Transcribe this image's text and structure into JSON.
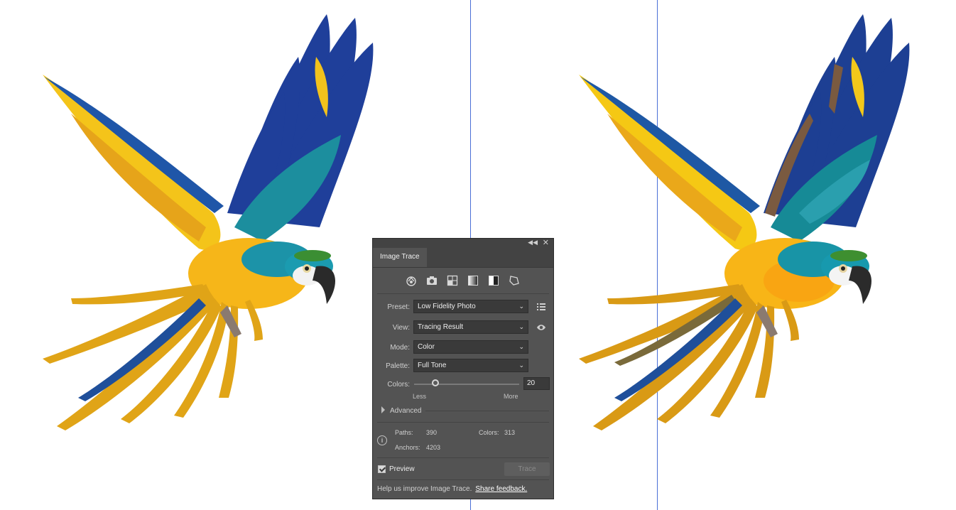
{
  "canvas": {
    "guide_color": "#4a6fd6"
  },
  "artwork": {
    "left": "original-photo",
    "right": "traced-vector"
  },
  "panel": {
    "title": "Image Trace",
    "icons": [
      "auto-color-icon",
      "high-color-icon",
      "low-color-icon",
      "grayscale-icon",
      "black-and-white-icon",
      "outline-icon"
    ],
    "preset": {
      "label": "Preset:",
      "value": "Low Fidelity Photo"
    },
    "view": {
      "label": "View:",
      "value": "Tracing Result"
    },
    "mode": {
      "label": "Mode:",
      "value": "Color"
    },
    "palette": {
      "label": "Palette:",
      "value": "Full Tone"
    },
    "colors": {
      "label": "Colors:",
      "value": "20",
      "less": "Less",
      "more": "More",
      "slider_fraction": 0.2
    },
    "advanced": "Advanced",
    "stats": {
      "paths_label": "Paths:",
      "paths": "390",
      "colors_label": "Colors:",
      "colors": "313",
      "anchors_label": "Anchors:",
      "anchors": "4203"
    },
    "preview": {
      "label": "Preview",
      "checked": true
    },
    "trace_button": "Trace",
    "footer": {
      "text": "Help us improve Image Trace.",
      "link": "Share feedback."
    }
  }
}
